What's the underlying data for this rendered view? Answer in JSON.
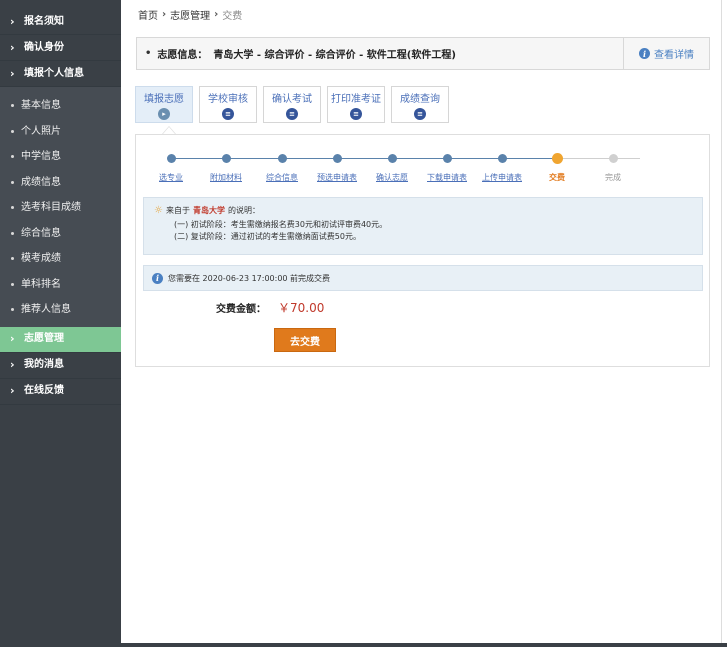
{
  "sidebar": {
    "sections_top": [
      {
        "label": "报名须知"
      },
      {
        "label": "确认身份"
      },
      {
        "label": "填报个人信息"
      }
    ],
    "sub_items": [
      {
        "label": "基本信息"
      },
      {
        "label": "个人照片"
      },
      {
        "label": "中学信息"
      },
      {
        "label": "成绩信息"
      },
      {
        "label": "选考科目成绩"
      },
      {
        "label": "综合信息"
      },
      {
        "label": "模考成绩"
      },
      {
        "label": "单科排名"
      },
      {
        "label": "推荐人信息"
      }
    ],
    "sections_bottom": [
      {
        "label": "志愿管理",
        "active": true
      },
      {
        "label": "我的消息"
      },
      {
        "label": "在线反馈"
      }
    ],
    "chevron": "›"
  },
  "breadcrumb": {
    "home": "首页",
    "level2": "志愿管理",
    "current": "交费",
    "separator": "›"
  },
  "info_bar": {
    "bullet": "•",
    "label": "志愿信息：",
    "value": "青岛大学 - 综合评价 - 综合评价 - 软件工程(软件工程)",
    "detail_link": "查看详情",
    "detail_icon": "info-icon"
  },
  "tabs": [
    {
      "label": "填报志愿",
      "icon": "play-icon",
      "active": true
    },
    {
      "label": "学校审核",
      "icon": "doc-icon"
    },
    {
      "label": "确认考试",
      "icon": "doc-icon"
    },
    {
      "label": "打印准考证",
      "icon": "doc-icon"
    },
    {
      "label": "成绩查询",
      "icon": "doc-icon"
    }
  ],
  "steps": [
    {
      "label": "选专业",
      "state": "done"
    },
    {
      "label": "附加材料",
      "state": "done"
    },
    {
      "label": "综合信息",
      "state": "done"
    },
    {
      "label": "预选申请表",
      "state": "done"
    },
    {
      "label": "确认志愿",
      "state": "done"
    },
    {
      "label": "下载申请表",
      "state": "done"
    },
    {
      "label": "上传申请表",
      "state": "done"
    },
    {
      "label": "交费",
      "state": "current"
    },
    {
      "label": "完成",
      "state": "future"
    }
  ],
  "notice": {
    "prefix": "来自于",
    "school": "青岛大学",
    "suffix": "的说明：",
    "line1": "(一) 初试阶段：考生需缴纳报名费30元和初试评审费40元。",
    "line2": "(二) 复试阶段：通过初试的考生需缴纳面试费50元。"
  },
  "deadline": {
    "text": "您需要在 2020-06-23 17:00:00 前完成交费"
  },
  "fee": {
    "label": "交费金额：",
    "amount": "￥70.00"
  },
  "pay_button": {
    "label": "去交费"
  },
  "colors": {
    "sidebar_bg": "#3a4046",
    "sidebar_active": "#7ec794",
    "accent_blue": "#4a80c2",
    "step_current": "#f0a530",
    "pay_button": "#e07a1c",
    "amount_red": "#c0392b"
  }
}
